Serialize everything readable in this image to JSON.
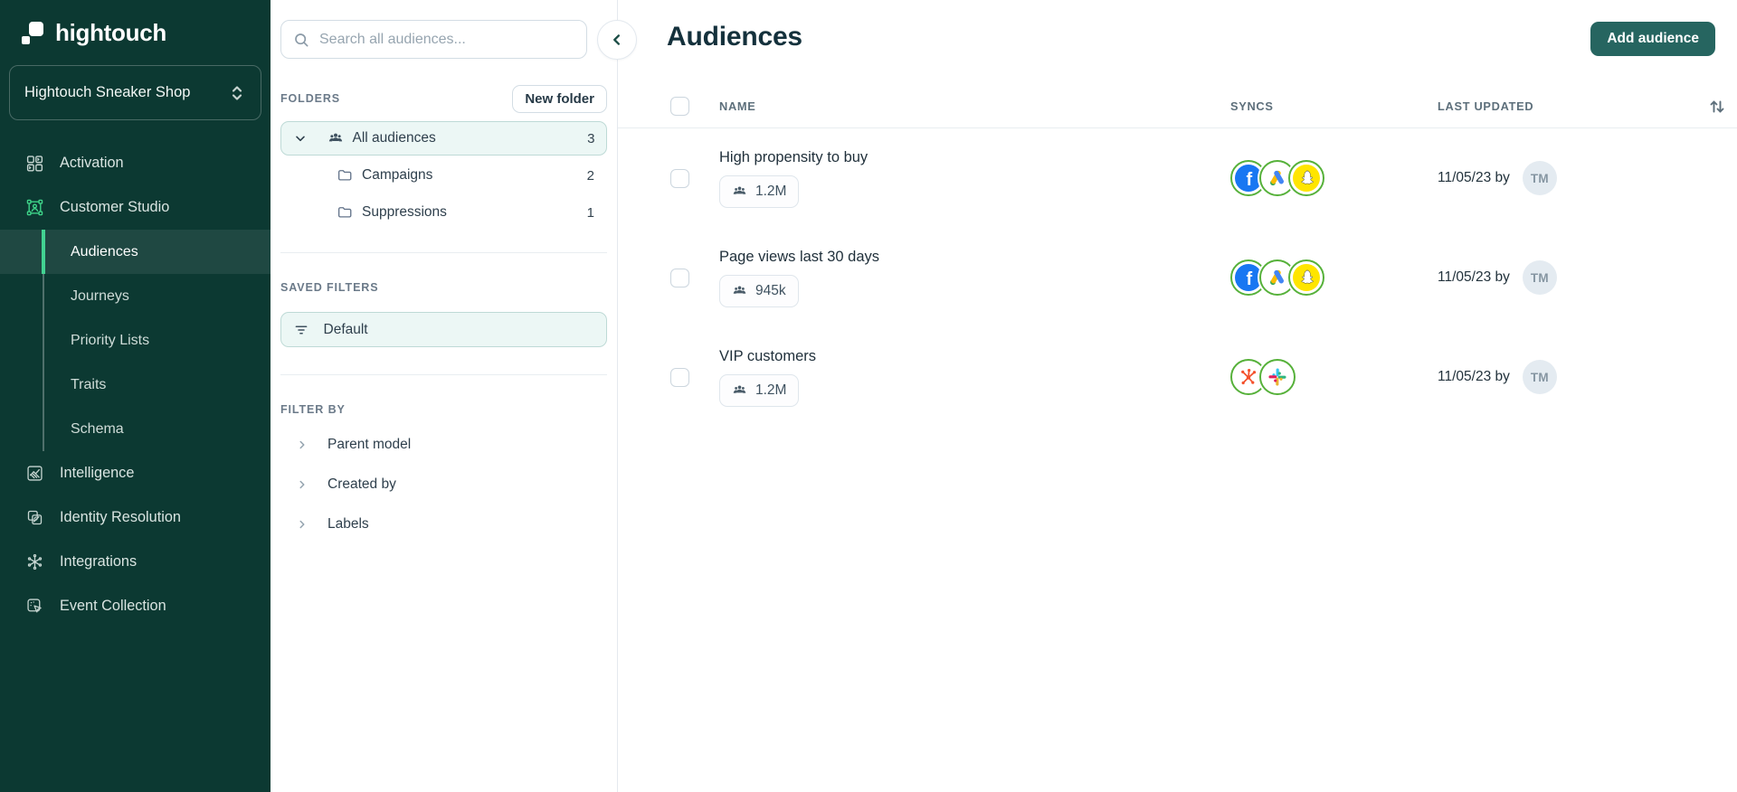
{
  "sidebar": {
    "logo_text": "hightouch",
    "workspace": {
      "name": "Hightouch Sneaker Shop"
    },
    "items": [
      {
        "label": "Activation"
      },
      {
        "label": "Customer Studio"
      },
      {
        "label": "Intelligence"
      },
      {
        "label": "Identity Resolution"
      },
      {
        "label": "Integrations"
      },
      {
        "label": "Event Collection"
      }
    ],
    "customer_studio_children": [
      {
        "label": "Audiences",
        "active": true
      },
      {
        "label": "Journeys"
      },
      {
        "label": "Priority Lists"
      },
      {
        "label": "Traits"
      },
      {
        "label": "Schema"
      }
    ]
  },
  "panel": {
    "search_placeholder": "Search all audiences...",
    "folders_header": "FOLDERS",
    "new_folder_label": "New folder",
    "folders": [
      {
        "name": "All audiences",
        "count": "3",
        "selected": true,
        "icon": "users-icon"
      },
      {
        "name": "Campaigns",
        "count": "2",
        "icon": "folder-icon"
      },
      {
        "name": "Suppressions",
        "count": "1",
        "icon": "folder-icon"
      }
    ],
    "saved_filters_header": "SAVED FILTERS",
    "saved_filters": [
      {
        "name": "Default",
        "icon": "filter-icon",
        "selected": true
      }
    ],
    "filter_by_header": "FILTER BY",
    "filter_groups": [
      {
        "label": "Parent model"
      },
      {
        "label": "Created by"
      },
      {
        "label": "Labels"
      }
    ]
  },
  "main": {
    "title": "Audiences",
    "add_button_label": "Add audience",
    "table": {
      "columns": {
        "name": "NAME",
        "syncs": "SYNCS",
        "last_updated": "LAST UPDATED"
      },
      "rows": [
        {
          "name": "High propensity to buy",
          "size": "1.2M",
          "syncs": [
            "Facebook",
            "Google Ads",
            "Snapchat"
          ],
          "last_updated": "11/05/23 by",
          "avatar": "TM"
        },
        {
          "name": "Page views last 30 days",
          "size": "945k",
          "syncs": [
            "Facebook",
            "Google Ads",
            "Snapchat"
          ],
          "last_updated": "11/05/23 by",
          "avatar": "TM"
        },
        {
          "name": "VIP customers",
          "size": "1.2M",
          "syncs": [
            "HubSpot",
            "Slack"
          ],
          "last_updated": "11/05/23 by",
          "avatar": "TM"
        }
      ]
    }
  },
  "colors": {
    "sidebar_bg": "#0c3932",
    "accent_green": "#42d392",
    "button_teal": "#266560",
    "selected_row_bg": "#ecf7f5",
    "selected_row_border": "#bedad6",
    "sync_ring_green": "#56b13a"
  }
}
